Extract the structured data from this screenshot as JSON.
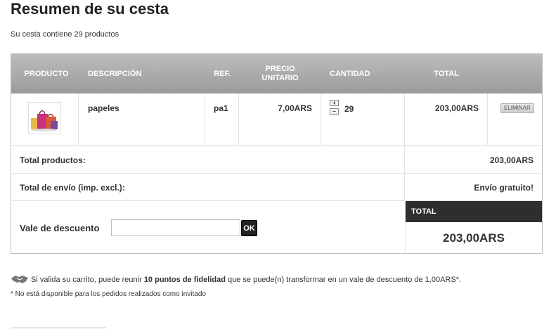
{
  "page": {
    "title": "Resumen de su cesta",
    "summary": "Su cesta contiene 29 productos"
  },
  "table": {
    "headers": {
      "product": "PRODUCTO",
      "description": "DESCRIPCIÓN",
      "ref": "REF.",
      "unit_price_line1": "PRECIO",
      "unit_price_line2": "UNITARIO",
      "quantity": "CANTIDAD",
      "total": "TOTAL"
    },
    "rows": [
      {
        "image_icon": "product-thumbnail",
        "description": "papeles",
        "ref": "pa1",
        "unit_price": "7,00ARS",
        "quantity": "29",
        "qty_up": "+",
        "qty_down": "−",
        "total": "203,00ARS",
        "delete_label": "ELIMINAR"
      }
    ]
  },
  "totals": {
    "products_label": "Total productos:",
    "products_value": "203,00ARS",
    "shipping_label": "Total de envío (imp. excl.):",
    "shipping_value": "Envío gratuito!",
    "grand_label": "TOTAL",
    "grand_value": "203,00ARS"
  },
  "voucher": {
    "label": "Vale de descuento",
    "input_value": "",
    "submit_label": "OK"
  },
  "loyalty": {
    "icon": "handshake-icon",
    "text_before": "Si valida su carrito, puede reunir ",
    "points_bold": "10 puntos de fidelidad",
    "text_after": " que se puede(n) transformar en un vale de descuento de 1,00ARS*.",
    "note": "* No está disponible para los pedidos realizados como invitado"
  },
  "colors": {
    "header_gradient_top": "#bdbdbd",
    "header_gradient_bottom": "#9a9a9a",
    "total_head_bg": "#2e2e2e"
  }
}
